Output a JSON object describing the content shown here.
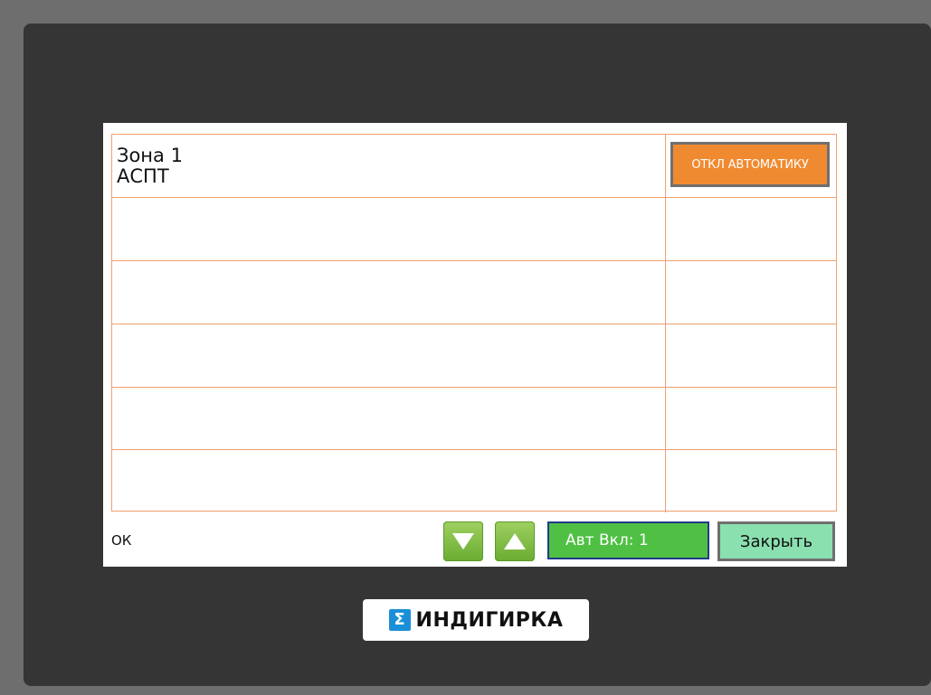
{
  "zones": [
    {
      "name": "Зона 1",
      "system": "АСПТ",
      "action_label": "ОТКЛ АВТОМАТИКУ"
    },
    {
      "name": "",
      "system": "",
      "action_label": ""
    },
    {
      "name": "",
      "system": "",
      "action_label": ""
    },
    {
      "name": "",
      "system": "",
      "action_label": ""
    },
    {
      "name": "",
      "system": "",
      "action_label": ""
    },
    {
      "name": "",
      "system": "",
      "action_label": ""
    }
  ],
  "footer": {
    "status_text": "ОК",
    "scroll_down_icon": "triangle-down-icon",
    "scroll_up_icon": "triangle-up-icon",
    "auto_status": "Авт Вкл: 1",
    "close_label": "Закрыть"
  },
  "brand": {
    "name": "ИНДИГИРКА",
    "mark": "Σ"
  },
  "colors": {
    "grid_line": "#f0a070",
    "action_button": "#f08a30",
    "auto_field": "#4fc043",
    "close_button": "#8be0b0",
    "arrow_button": "#7ec040",
    "logo_mark": "#1a8fd8"
  }
}
